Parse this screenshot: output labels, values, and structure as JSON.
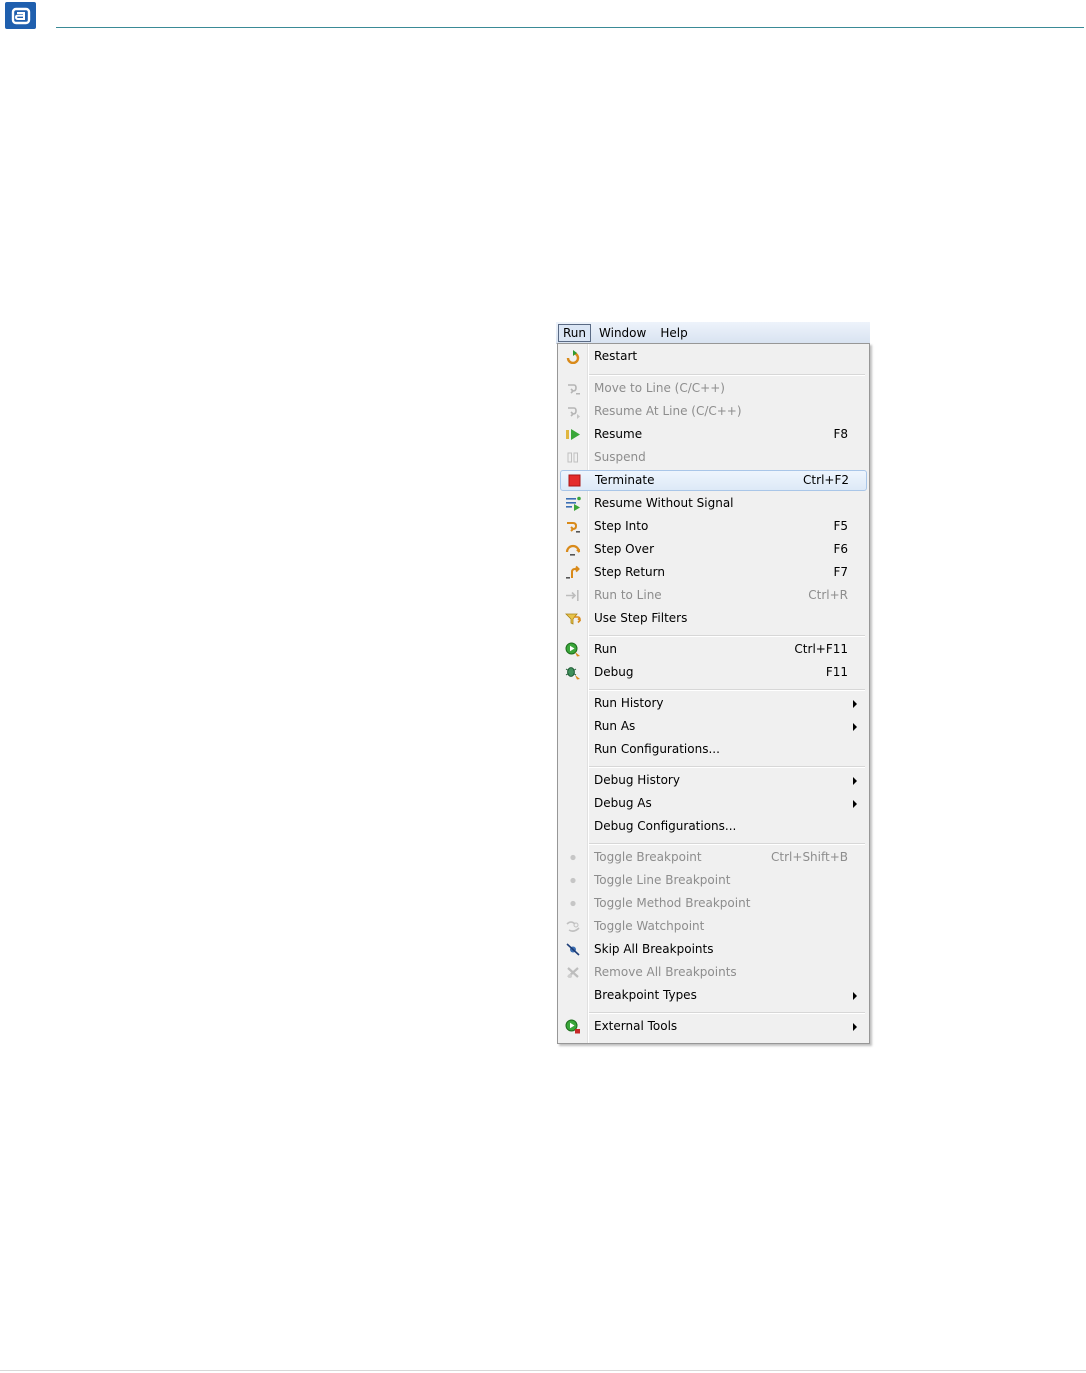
{
  "colors": {
    "logo_bg": "#1f5fae",
    "header_rule": "#3a8a96",
    "menu_bg": "#f0f0f0",
    "disabled_text": "#8d8d8d",
    "highlight_border": "#a9c6e8"
  },
  "menubar": {
    "items": [
      {
        "label": "Run",
        "active": true
      },
      {
        "label": "Window",
        "active": false
      },
      {
        "label": "Help",
        "active": false
      }
    ]
  },
  "menu": {
    "items": [
      {
        "label": "Restart",
        "shortcut": "",
        "icon": "restart-icon",
        "disabled": false
      },
      {
        "label": "Move to Line (C/C++)",
        "shortcut": "",
        "icon": "move-to-line-icon",
        "disabled": true
      },
      {
        "label": "Resume At Line (C/C++)",
        "shortcut": "",
        "icon": "resume-at-line-icon",
        "disabled": true
      },
      {
        "label": "Resume",
        "shortcut": "F8",
        "icon": "resume-icon",
        "disabled": false
      },
      {
        "label": "Suspend",
        "shortcut": "",
        "icon": "suspend-icon",
        "disabled": true
      },
      {
        "label": "Terminate",
        "shortcut": "Ctrl+F2",
        "icon": "terminate-icon",
        "disabled": false,
        "highlighted": true
      },
      {
        "label": "Resume Without Signal",
        "shortcut": "",
        "icon": "resume-without-signal-icon",
        "disabled": false
      },
      {
        "label": "Step Into",
        "shortcut": "F5",
        "icon": "step-into-icon",
        "disabled": false
      },
      {
        "label": "Step Over",
        "shortcut": "F6",
        "icon": "step-over-icon",
        "disabled": false
      },
      {
        "label": "Step Return",
        "shortcut": "F7",
        "icon": "step-return-icon",
        "disabled": false
      },
      {
        "label": "Run to Line",
        "shortcut": "Ctrl+R",
        "icon": "run-to-line-icon",
        "disabled": true
      },
      {
        "label": "Use Step Filters",
        "shortcut": "",
        "icon": "step-filters-icon",
        "disabled": false
      },
      {
        "label": "Run",
        "shortcut": "Ctrl+F11",
        "icon": "run-icon",
        "disabled": false
      },
      {
        "label": "Debug",
        "shortcut": "F11",
        "icon": "debug-icon",
        "disabled": false
      },
      {
        "label": "Run History",
        "shortcut": "",
        "icon": "",
        "disabled": false,
        "submenu": true
      },
      {
        "label": "Run As",
        "shortcut": "",
        "icon": "",
        "disabled": false,
        "submenu": true
      },
      {
        "label": "Run Configurations...",
        "shortcut": "",
        "icon": "",
        "disabled": false
      },
      {
        "label": "Debug History",
        "shortcut": "",
        "icon": "",
        "disabled": false,
        "submenu": true
      },
      {
        "label": "Debug As",
        "shortcut": "",
        "icon": "",
        "disabled": false,
        "submenu": true
      },
      {
        "label": "Debug Configurations...",
        "shortcut": "",
        "icon": "",
        "disabled": false
      },
      {
        "label": "Toggle Breakpoint",
        "shortcut": "Ctrl+Shift+B",
        "icon": "breakpoint-dot-icon",
        "disabled": true
      },
      {
        "label": "Toggle Line Breakpoint",
        "shortcut": "",
        "icon": "breakpoint-dot-icon",
        "disabled": true
      },
      {
        "label": "Toggle Method Breakpoint",
        "shortcut": "",
        "icon": "breakpoint-dot-icon",
        "disabled": true
      },
      {
        "label": "Toggle Watchpoint",
        "shortcut": "",
        "icon": "watchpoint-icon",
        "disabled": true
      },
      {
        "label": "Skip All Breakpoints",
        "shortcut": "",
        "icon": "skip-breakpoints-icon",
        "disabled": false
      },
      {
        "label": "Remove All Breakpoints",
        "shortcut": "",
        "icon": "remove-breakpoints-icon",
        "disabled": true
      },
      {
        "label": "Breakpoint Types",
        "shortcut": "",
        "icon": "",
        "disabled": false,
        "submenu": true
      },
      {
        "label": "External Tools",
        "shortcut": "",
        "icon": "external-tools-icon",
        "disabled": false,
        "submenu": true
      }
    ]
  }
}
